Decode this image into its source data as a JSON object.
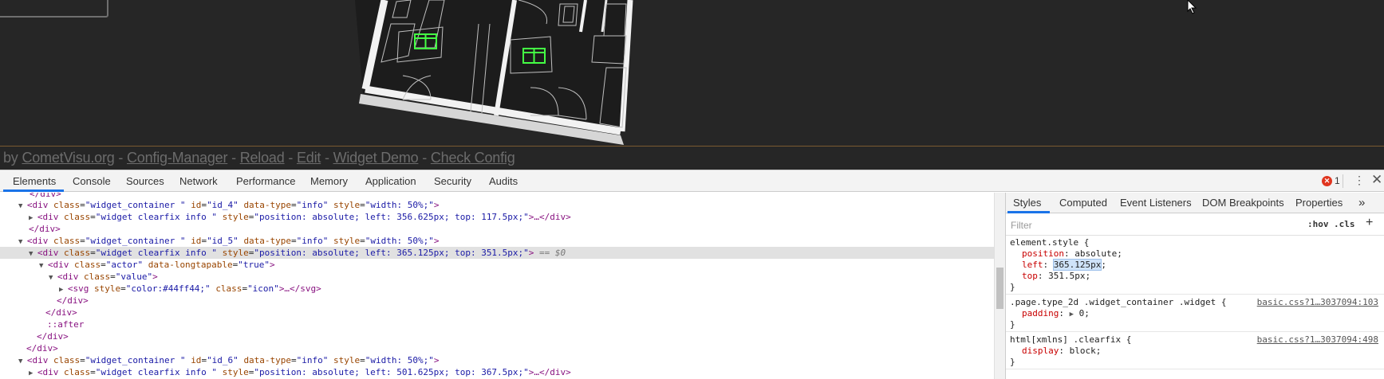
{
  "app": {
    "footer": {
      "prefix": "by",
      "links": [
        "CometVisu.org",
        "Config-Manager",
        "Reload",
        "Edit",
        "Widget Demo",
        "Check Config"
      ],
      "separator": "-"
    },
    "accent_color": "#44ff44"
  },
  "devtools": {
    "tabs": [
      "Elements",
      "Console",
      "Sources",
      "Network",
      "Performance",
      "Memory",
      "Application",
      "Security",
      "Audits"
    ],
    "active_tab": "Elements",
    "error_count": "1",
    "dom_lines": {
      "l0": {
        "close": "</div>"
      },
      "l1": {
        "open": "<div ",
        "a1": "class",
        "v1": "\"widget_container \"",
        "a2": "id",
        "v2": "\"id_4\"",
        "a3": "data-type",
        "v3": "\"info\"",
        "a4": "style",
        "v4": "\"width: 50%;\"",
        "end": ">"
      },
      "l2": {
        "open": "<div ",
        "a1": "class",
        "v1": "\"widget clearfix info \"",
        "a2": "style",
        "v2": "\"position: absolute; left: 356.625px; top: 117.5px;\"",
        "end": ">…</div>"
      },
      "l3": {
        "close": "</div>"
      },
      "l4": {
        "open": "<div ",
        "a1": "class",
        "v1": "\"widget_container \"",
        "a2": "id",
        "v2": "\"id_5\"",
        "a3": "data-type",
        "v3": "\"info\"",
        "a4": "style",
        "v4": "\"width: 50%;\"",
        "end": ">"
      },
      "l5": {
        "open": "<div ",
        "a1": "class",
        "v1": "\"widget clearfix info \"",
        "a2": "style",
        "v2": "\"position: absolute; left: 365.125px; top: 351.5px;\"",
        "end": ">",
        "marker": " == $0"
      },
      "l6": {
        "open": "<div ",
        "a1": "class",
        "v1": "\"actor\"",
        "a2": "data-longtapable",
        "v2": "\"true\"",
        "end": ">"
      },
      "l7": {
        "open": "<div ",
        "a1": "class",
        "v1": "\"value\"",
        "end": ">"
      },
      "l8": {
        "open": "<svg ",
        "a1": "style",
        "v1": "\"color:#44ff44;\"",
        "a2": "class",
        "v2": "\"icon\"",
        "end": ">…</svg>"
      },
      "l9": {
        "close": "</div>"
      },
      "l10": {
        "close": "</div>"
      },
      "l11": {
        "pseudo": "::after"
      },
      "l12": {
        "close": "</div>"
      },
      "l13": {
        "close": "</div>"
      },
      "l14": {
        "open": "<div ",
        "a1": "class",
        "v1": "\"widget_container \"",
        "a2": "id",
        "v2": "\"id_6\"",
        "a3": "data-type",
        "v3": "\"info\"",
        "a4": "style",
        "v4": "\"width: 50%;\"",
        "end": ">"
      },
      "l15": {
        "open": "<div ",
        "a1": "class",
        "v1": "\"widget clearfix info \"",
        "a2": "style",
        "v2": "\"position: absolute; left: 501.625px; top: 367.5px;\"",
        "end": ">…</div>"
      }
    },
    "styles_panel": {
      "tabs": [
        "Styles",
        "Computed",
        "Event Listeners",
        "DOM Breakpoints",
        "Properties"
      ],
      "active_tab": "Styles",
      "more_icon": "chevron-double-right-icon",
      "filter_placeholder": "Filter",
      "hov_label": ":hov",
      "cls_label": ".cls",
      "element_style": {
        "selector": "element.style {",
        "p1": "position",
        "v1": "absolute;",
        "p2": "left",
        "v2": "365.125px",
        "p3": "top",
        "v3": "351.5px;",
        "close": "}"
      },
      "rule2": {
        "selector": ".page.type_2d .widget_container .widget {",
        "source": "basic.css?1…3037094:103",
        "p1": "padding",
        "v1": "0;",
        "close": "}"
      },
      "rule3": {
        "selector": "html[xmlns] .clearfix {",
        "source": "basic.css?1…3037094:498",
        "p1": "display",
        "v1": "block;",
        "close": "}"
      }
    }
  }
}
